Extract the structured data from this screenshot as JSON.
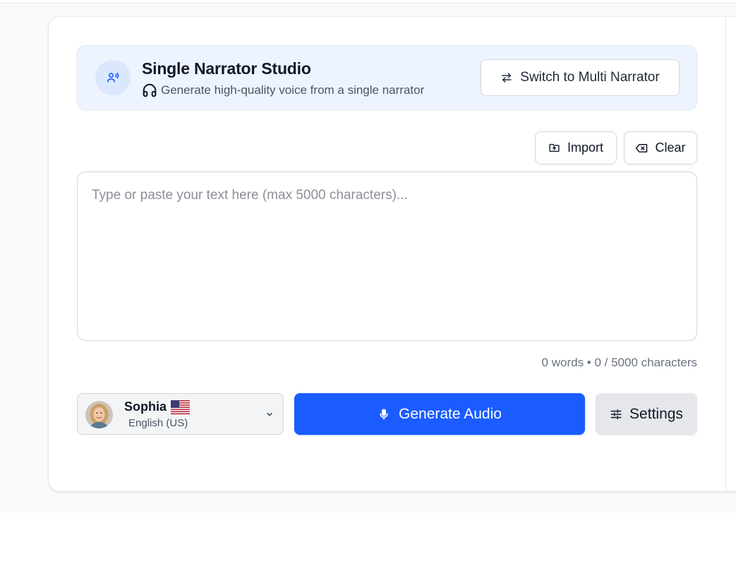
{
  "banner": {
    "title": "Single Narrator Studio",
    "subtitle": "Generate high-quality voice from a single narrator",
    "switch_label": "Switch to Multi Narrator",
    "icons": {
      "narrator": "voice-narrator-icon",
      "subtitle": "headphones-icon",
      "switch": "swap-arrows-icon"
    }
  },
  "toolbar": {
    "import_label": "Import",
    "clear_label": "Clear",
    "icons": {
      "import": "folder-upload-icon",
      "clear": "backspace-icon"
    }
  },
  "editor": {
    "placeholder": "Type or paste your text here (max 5000 characters)...",
    "value": ""
  },
  "counter": {
    "text": "0 words • 0 / 5000 characters",
    "words": 0,
    "characters": 0,
    "max_characters": 5000
  },
  "voice": {
    "name": "Sophia",
    "language": "English (US)",
    "flag": "us-flag-icon"
  },
  "actions": {
    "generate_label": "Generate Audio",
    "settings_label": "Settings",
    "icons": {
      "generate": "microphone-icon",
      "settings": "sliders-icon"
    }
  },
  "colors": {
    "accent": "#1a5cff",
    "banner_bg": "#eef4ff",
    "page_bg": "#f9fafb"
  }
}
